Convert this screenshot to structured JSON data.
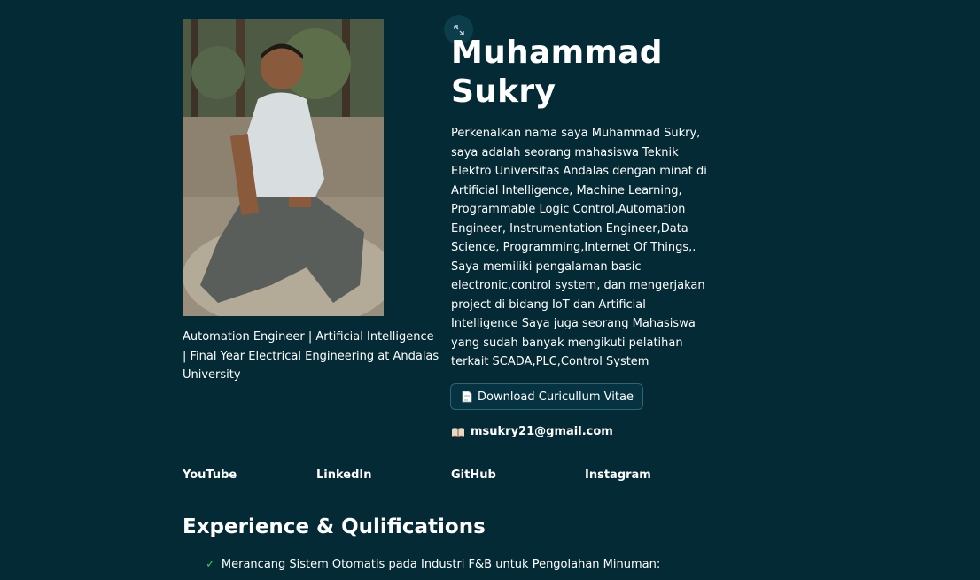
{
  "profile": {
    "name": "Muhammad Sukry",
    "tagline": "Automation Engineer | Artificial Intelligence | Final Year Electrical Engineering at Andalas University",
    "bio": "Perkenalkan nama saya Muhammad Sukry, saya adalah seorang mahasiswa Teknik Elektro Universitas Andalas dengan minat di Artificial Intelligence, Machine Learning, Programmable Logic Control,Automation Engineer, Instrumentation Engineer,Data Science, Programming,Internet Of Things,. Saya memiliki pengalaman basic electronic,control system, dan mengerjakan project di bidang IoT dan Artificial Intelligence Saya juga seorang Mahasiswa yang sudah banyak mengikuti pelatihan terkait SCADA,PLC,Control System"
  },
  "actions": {
    "download_cv_label": "Download Curicullum Vitae",
    "download_cv_icon": "document-icon",
    "email": "msukry21@gmail.com",
    "email_icon": "book-icon"
  },
  "social": [
    {
      "label": "YouTube"
    },
    {
      "label": "LinkedIn"
    },
    {
      "label": "GitHub"
    },
    {
      "label": "Instagram"
    }
  ],
  "experience": {
    "title": "Experience & Qulifications",
    "items": [
      {
        "text": "Merancang Sistem Otomatis pada Industri F&B untuk Pengolahan Minuman:"
      }
    ]
  },
  "colors": {
    "background": "#042a35",
    "accent_check": "#37c75a"
  }
}
